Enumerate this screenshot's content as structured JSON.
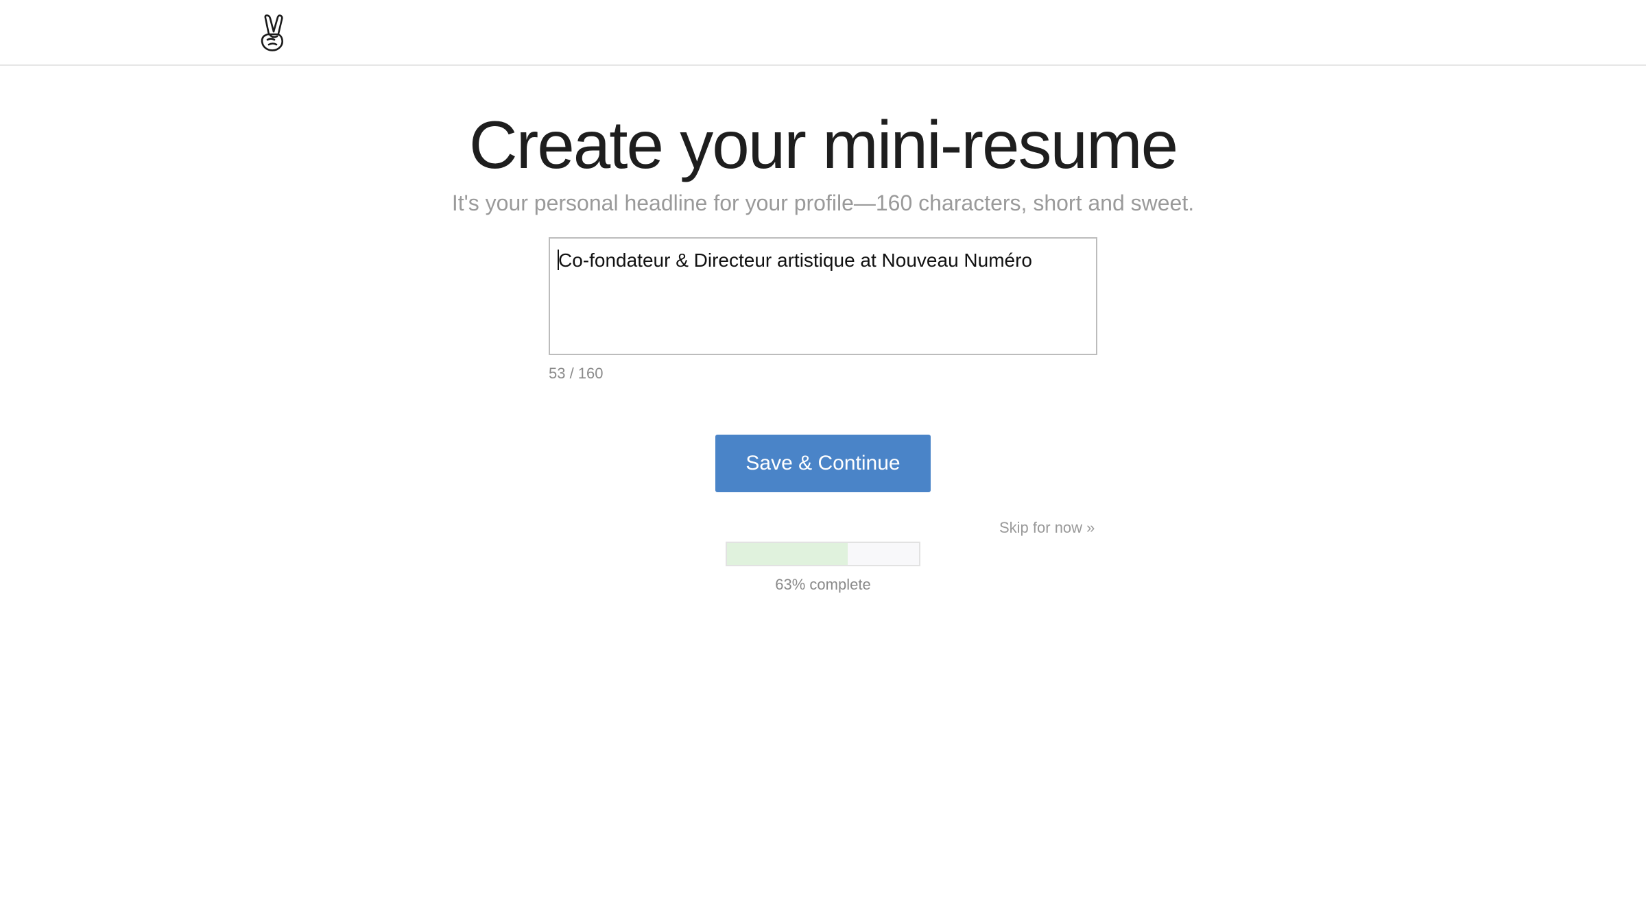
{
  "header": {
    "logo_icon": "peace-hand-icon"
  },
  "main": {
    "title": "Create your mini-resume",
    "subtitle": "It's your personal headline for your profile—160 characters, short and sweet.",
    "headline_value": "Co-fondateur & Directeur artistique at Nouveau Numéro",
    "char_counter": "53 / 160",
    "save_label": "Save & Continue",
    "skip_label": "Skip for now »",
    "progress_fraction": 0.63,
    "progress_text": "63% complete"
  },
  "colors": {
    "primary_button": "#4a84c8",
    "progress_fill": "#e0f2dd",
    "muted_text": "#9a9a9a"
  }
}
